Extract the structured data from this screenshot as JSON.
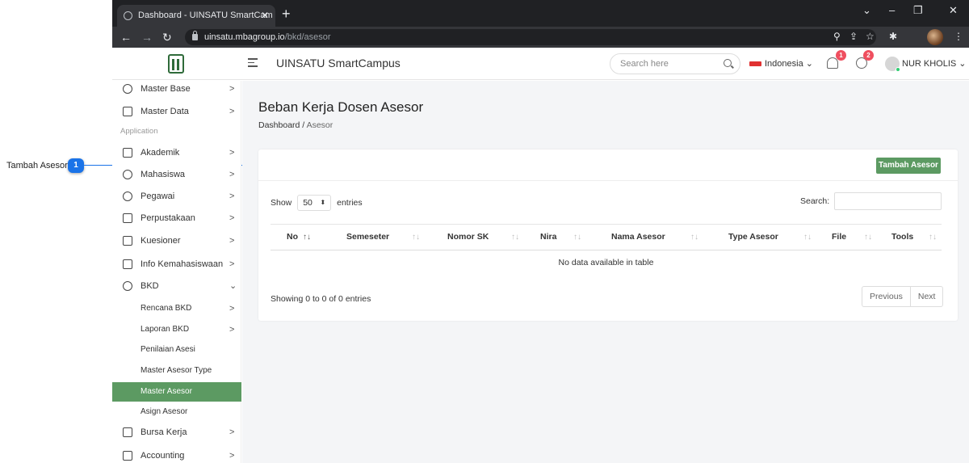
{
  "annotation": {
    "label": "Tambah Asesor",
    "number": "1",
    "color": "#1a73e8"
  },
  "browser": {
    "tab_title": "Dashboard - UINSATU SmartCam",
    "url_host": "uinsatu.mbagroup.io",
    "url_path": "/bkd/asesor"
  },
  "header": {
    "app_title": "UINSATU SmartCampus",
    "search_placeholder": "Search here",
    "language": "Indonesia",
    "notif_count": "1",
    "chat_count": "2",
    "username": "NUR KHOLIS"
  },
  "sidebar": {
    "items_top": [
      {
        "label": "Master Base",
        "icon": "puzzle-icon"
      },
      {
        "label": "Master Data",
        "icon": "cube-icon"
      }
    ],
    "section_label": "Application",
    "items": [
      {
        "label": "Akademik",
        "icon": "graduation-cap-icon"
      },
      {
        "label": "Mahasiswa",
        "icon": "users-icon"
      },
      {
        "label": "Pegawai",
        "icon": "user-icon"
      },
      {
        "label": "Perpustakaan",
        "icon": "book-icon"
      },
      {
        "label": "Kuesioner",
        "icon": "copy-icon"
      },
      {
        "label": "Info Kemahasiswaan",
        "icon": "printer-icon"
      },
      {
        "label": "BKD",
        "icon": "tool-icon"
      }
    ],
    "bkd_subitems": [
      {
        "label": "Rencana BKD",
        "has_chevron": true
      },
      {
        "label": "Laporan BKD",
        "has_chevron": true
      },
      {
        "label": "Penilaian Asesi",
        "has_chevron": false
      },
      {
        "label": "Master Asesor Type",
        "has_chevron": false
      },
      {
        "label": "Master Asesor",
        "has_chevron": false,
        "active": true
      },
      {
        "label": "Asign Asesor",
        "has_chevron": false
      }
    ],
    "items_bottom": [
      {
        "label": "Bursa Kerja",
        "icon": "briefcase-icon"
      },
      {
        "label": "Accounting",
        "icon": "money-icon"
      }
    ],
    "accent": "#5c9a62"
  },
  "main": {
    "page_title": "Beban Kerja Dosen Asesor",
    "breadcrumb_root": "Dashboard",
    "breadcrumb_sep": "/",
    "breadcrumb_current": "Asesor",
    "add_button": "Tambah Asesor",
    "show_label": "Show",
    "entries_value": "50",
    "entries_label": "entries",
    "search_label": "Search:",
    "columns": [
      "No",
      "Semeseter",
      "Nomor SK",
      "Nira",
      "Nama Asesor",
      "Type Asesor",
      "File",
      "Tools"
    ],
    "empty_text": "No data available in table",
    "info_text": "Showing 0 to 0 of 0 entries",
    "prev_label": "Previous",
    "next_label": "Next"
  }
}
